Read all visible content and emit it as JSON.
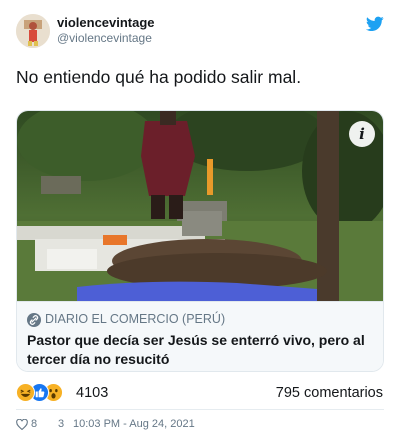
{
  "author": {
    "display_name": "violencevintage",
    "handle": "@violencevintage"
  },
  "tweet": {
    "text": "No entiendo qué ha podido salir mal."
  },
  "card": {
    "source": "DIARIO EL COMERCIO (PERÚ)",
    "headline": "Pastor que decía ser Jesús se enterró vivo, pero al tercer día no resucitó",
    "info_icon": "i"
  },
  "reactions": {
    "icons": [
      "haha-icon",
      "like-icon",
      "wow-icon"
    ],
    "count": "4103",
    "comments": "795 comentarios"
  },
  "footer": {
    "likes": "8",
    "replies": "3",
    "timestamp": "10:03 PM - Aug 24, 2021"
  },
  "colors": {
    "twitter_blue": "#1da1f2",
    "facebook_blue": "#1877f2",
    "reaction_yellow": "#f7b125",
    "muted_text": "#657786"
  }
}
